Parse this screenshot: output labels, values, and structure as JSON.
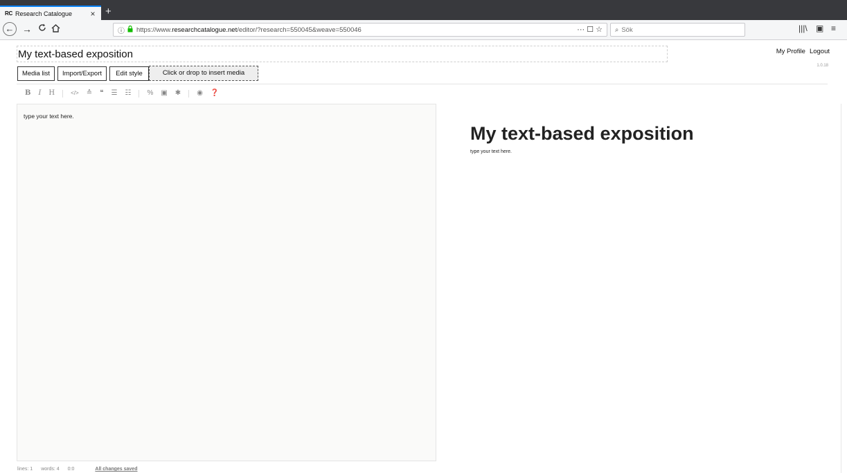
{
  "browser": {
    "tab_favicon": "RC",
    "tab_title": "Research Catalogue",
    "tab_close": "×",
    "new_tab": "+",
    "url_prefix": "https://www.",
    "url_domain": "researchcatalogue.net",
    "url_path": "/editor/?research=550045&weave=550046",
    "url_actions": "··· ☐ ☆",
    "search_placeholder": "Sök",
    "icons": {
      "back": "←",
      "forward": "→",
      "reload": "C",
      "home": "⌂",
      "info": "ⓘ",
      "lock": "🔒",
      "library": "|||\\",
      "sidebar": "▣",
      "menu": "≡",
      "search": "⌕"
    }
  },
  "page": {
    "title": "My text-based exposition",
    "my_profile": "My Profile",
    "logout": "Logout",
    "version": "1.0.18"
  },
  "toolbar": {
    "media_list": "Media list",
    "import_export": "Import/Export",
    "edit_style": "Edit style",
    "dropzone": "Click or drop to insert media"
  },
  "format_bar": {
    "bold": "B",
    "italic": "I",
    "heading": "H",
    "code": "</>",
    "upload": "≙",
    "quote": "❝",
    "bullet_list": "☰",
    "numbered_list": "☷",
    "link": "%",
    "image": "▣",
    "asterisk": "✱",
    "preview": "◉",
    "help": "❓"
  },
  "editor": {
    "text": "type your text here."
  },
  "preview": {
    "title": "My text-based exposition",
    "body": "type your text here."
  },
  "status": {
    "lines": "lines: 1",
    "words": "words: 4",
    "cursor": "0:0",
    "saved": "All changes saved"
  }
}
